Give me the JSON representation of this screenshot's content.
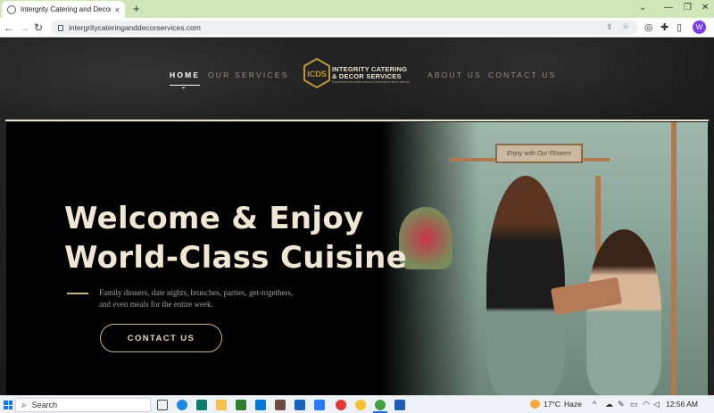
{
  "browser": {
    "tab_title": "Intergrity Catering and Decor Se",
    "tab_close": "×",
    "new_tab": "+",
    "url": "intergritycateringanddecorservices.com",
    "profile_initial": "W"
  },
  "site": {
    "nav": {
      "home": "HOME",
      "services": "OUR SERVICES",
      "about": "ABOUT US",
      "contact": "CONTACT US"
    },
    "logo": {
      "monogram": "ICDS",
      "line1": "INTEGRITY CATERING",
      "line2": "& DECOR SERVICES",
      "tagline": "Experience the perfect blend of flavours & decor with us"
    },
    "hero": {
      "headline_1": "Welcome & Enjoy",
      "headline_2": "World-Class Cuisine",
      "sub_1": "Family dinners, date nights, brunches, parties, get-togethers,",
      "sub_2": "and even meals for the entire week.",
      "cta": "CONTACT US",
      "sign_text": "Enjoy with Our Flowers"
    },
    "colors": {
      "accent": "#c9b48a",
      "headline": "#efe6d4",
      "logo_gold": "#b89a3b"
    }
  },
  "taskbar": {
    "search_label": "Search",
    "weather_temp": "17°C",
    "weather_desc": "Haze",
    "time": "12:56 AM"
  }
}
